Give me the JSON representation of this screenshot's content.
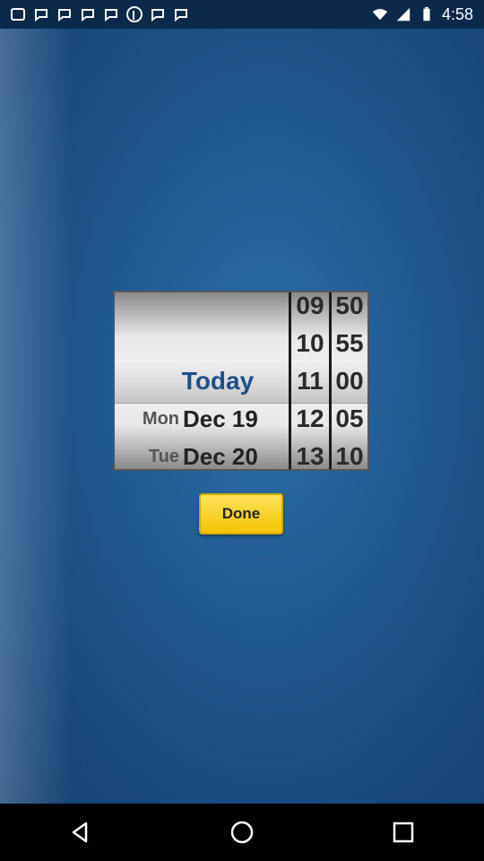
{
  "status_bar": {
    "time": "4:58",
    "left_icons": [
      "notification-icon",
      "notification-icon",
      "notification-icon",
      "notification-icon",
      "notification-icon",
      "pinterest-icon",
      "notification-icon",
      "notification-icon"
    ],
    "right_icons": [
      "wifi-icon",
      "signal-icon",
      "battery-icon"
    ]
  },
  "picker": {
    "day_wheel": [
      {
        "dow": "",
        "date": ""
      },
      {
        "dow": "",
        "date": ""
      },
      {
        "label": "Today"
      },
      {
        "dow": "Mon",
        "date": "Dec 19"
      },
      {
        "dow": "Tue",
        "date": "Dec 20"
      }
    ],
    "hour_wheel": [
      "09",
      "10",
      "11",
      "12",
      "13"
    ],
    "minute_wheel": [
      "50",
      "55",
      "00",
      "05",
      "10"
    ],
    "selected": {
      "day": "Today",
      "hour": "11",
      "minute": "00"
    }
  },
  "done_button": {
    "label": "Done"
  },
  "nav_bar": {
    "back": "back-icon",
    "home": "home-icon",
    "recents": "recents-icon"
  },
  "colors": {
    "accent": "#f5c400",
    "background": "#1f5a92",
    "today_text": "#1e4f86"
  }
}
